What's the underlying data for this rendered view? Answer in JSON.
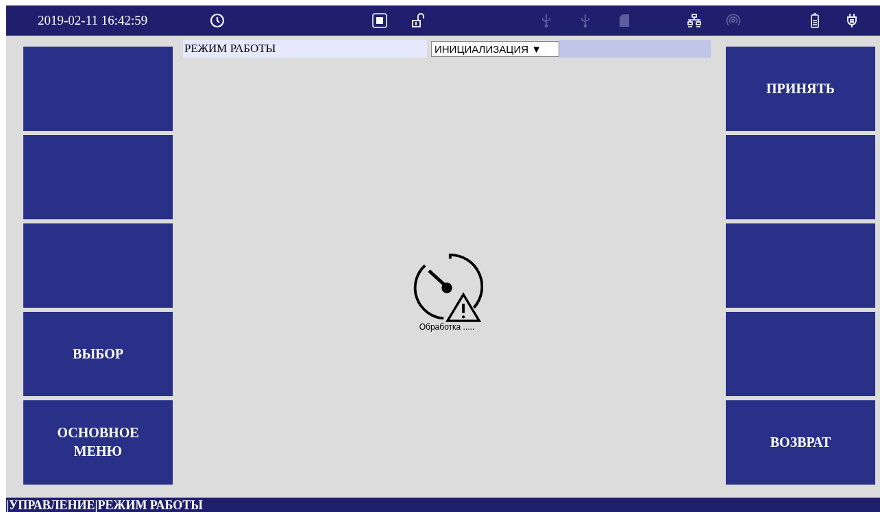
{
  "top_bar": {
    "datetime": "2019-02-11 16:42:59",
    "indicators": [
      {
        "kind": "clock",
        "active": true
      },
      {
        "kind": "stop",
        "active": true
      },
      {
        "kind": "lock",
        "active": true
      },
      {
        "kind": "usb",
        "active": false
      },
      {
        "kind": "usb",
        "active": false
      },
      {
        "kind": "sd",
        "active": false
      },
      {
        "kind": "network",
        "active": true
      },
      {
        "kind": "antenna",
        "active": false
      },
      {
        "kind": "battery",
        "active": true
      },
      {
        "kind": "plug",
        "active": true
      }
    ]
  },
  "mode": {
    "label": "РЕЖИМ РАБОТЫ",
    "value": "ИНИЦИАЛИЗАЦИЯ",
    "caret": "▼"
  },
  "left_buttons": [
    {
      "kind": "blank"
    },
    {
      "kind": "blank"
    },
    {
      "kind": "blank"
    },
    {
      "kind": "labeled",
      "label": "ВЫБОР"
    },
    {
      "kind": "labeled",
      "label": "ОСНОВНОЕ МЕНЮ"
    }
  ],
  "right_buttons": [
    {
      "kind": "labeled",
      "label": "ПРИНЯТЬ"
    },
    {
      "kind": "blank"
    },
    {
      "kind": "blank"
    },
    {
      "kind": "blank"
    },
    {
      "kind": "labeled",
      "label": "ВОЗВРАТ"
    }
  ],
  "status": {
    "text": "Обработка ....."
  },
  "breadcrumb": "|УПРАВЛЕНИЕ|РЕЖИМ РАБОТЫ"
}
